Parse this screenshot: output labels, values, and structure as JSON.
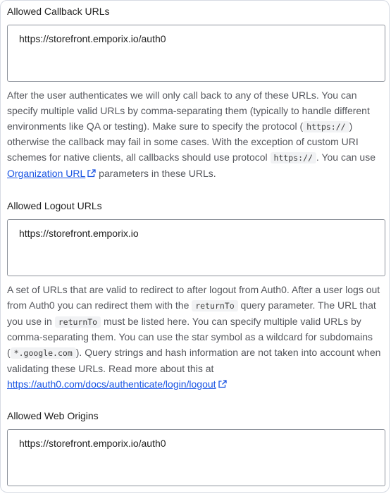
{
  "callback": {
    "label": "Allowed Callback URLs",
    "value": "https://storefront.emporix.io/auth0",
    "help_1": "After the user authenticates we will only call back to any of these URLs. You can specify multiple valid URLs by comma-separating them (typically to handle different environments like QA or testing). Make sure to specify the protocol (",
    "code_protocol": "https://",
    "help_2": ") otherwise the callback may fail in some cases. With the exception of custom URI schemes for native clients, all callbacks should use protocol",
    "code_protocol_2": "https://",
    "help_3": ". You can use",
    "link_org_url": "Organization URL",
    "help_4": "parameters in these URLs."
  },
  "logout": {
    "label": "Allowed Logout URLs",
    "value": "https://storefront.emporix.io",
    "help_1": "A set of URLs that are valid to redirect to after logout from Auth0. After a user logs out from Auth0 you can redirect them with the",
    "code_returnto": "returnTo",
    "help_2": "query parameter. The URL that you use in",
    "code_returnto_2": "returnTo",
    "help_3": "must be listed here. You can specify multiple valid URLs by comma-separating them. You can use the star symbol as a wildcard for subdomains (",
    "code_wildcard": "*.google.com",
    "help_4": "). Query strings and hash information are not taken into account when validating these URLs. Read more about this at",
    "link_docs": "https://auth0.com/docs/authenticate/login/logout"
  },
  "web_origins": {
    "label": "Allowed Web Origins",
    "value": "https://storefront.emporix.io/auth0"
  },
  "colors": {
    "link": "#1a55e3",
    "border": "#8e939c",
    "help_text": "#55575d"
  },
  "icons": [
    "external-link-icon"
  ]
}
